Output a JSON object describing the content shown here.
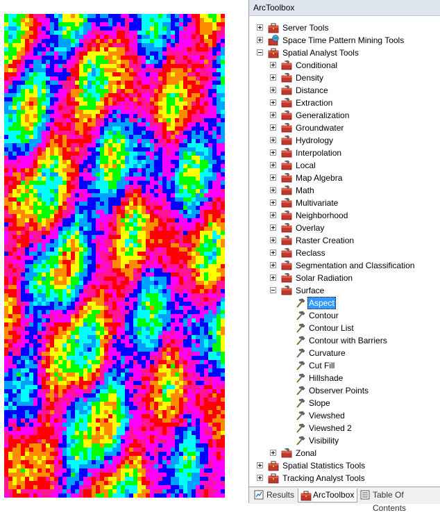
{
  "panel": {
    "title": "ArcToolbox"
  },
  "tree": [
    {
      "label": "Server Tools",
      "level": 0,
      "state": "collapsed",
      "icon": "toolbox-icon"
    },
    {
      "label": "Space Time Pattern Mining Tools",
      "level": 0,
      "state": "collapsed",
      "icon": "toolbox-globe-icon"
    },
    {
      "label": "Spatial Analyst Tools",
      "level": 0,
      "state": "expanded",
      "icon": "toolbox-icon"
    },
    {
      "label": "Conditional",
      "level": 1,
      "state": "collapsed",
      "icon": "toolset-icon"
    },
    {
      "label": "Density",
      "level": 1,
      "state": "collapsed",
      "icon": "toolset-icon"
    },
    {
      "label": "Distance",
      "level": 1,
      "state": "collapsed",
      "icon": "toolset-icon"
    },
    {
      "label": "Extraction",
      "level": 1,
      "state": "collapsed",
      "icon": "toolset-icon"
    },
    {
      "label": "Generalization",
      "level": 1,
      "state": "collapsed",
      "icon": "toolset-icon"
    },
    {
      "label": "Groundwater",
      "level": 1,
      "state": "collapsed",
      "icon": "toolset-icon"
    },
    {
      "label": "Hydrology",
      "level": 1,
      "state": "collapsed",
      "icon": "toolset-icon"
    },
    {
      "label": "Interpolation",
      "level": 1,
      "state": "collapsed",
      "icon": "toolset-icon"
    },
    {
      "label": "Local",
      "level": 1,
      "state": "collapsed",
      "icon": "toolset-icon"
    },
    {
      "label": "Map Algebra",
      "level": 1,
      "state": "collapsed",
      "icon": "toolset-icon"
    },
    {
      "label": "Math",
      "level": 1,
      "state": "collapsed",
      "icon": "toolset-icon"
    },
    {
      "label": "Multivariate",
      "level": 1,
      "state": "collapsed",
      "icon": "toolset-icon"
    },
    {
      "label": "Neighborhood",
      "level": 1,
      "state": "collapsed",
      "icon": "toolset-icon"
    },
    {
      "label": "Overlay",
      "level": 1,
      "state": "collapsed",
      "icon": "toolset-icon"
    },
    {
      "label": "Raster Creation",
      "level": 1,
      "state": "collapsed",
      "icon": "toolset-icon"
    },
    {
      "label": "Reclass",
      "level": 1,
      "state": "collapsed",
      "icon": "toolset-icon"
    },
    {
      "label": "Segmentation and Classification",
      "level": 1,
      "state": "collapsed",
      "icon": "toolset-icon"
    },
    {
      "label": "Solar Radiation",
      "level": 1,
      "state": "collapsed",
      "icon": "toolset-icon"
    },
    {
      "label": "Surface",
      "level": 1,
      "state": "expanded",
      "icon": "toolset-icon"
    },
    {
      "label": "Aspect",
      "level": 2,
      "state": "leaf",
      "icon": "hammer-icon",
      "selected": true
    },
    {
      "label": "Contour",
      "level": 2,
      "state": "leaf",
      "icon": "hammer-icon"
    },
    {
      "label": "Contour List",
      "level": 2,
      "state": "leaf",
      "icon": "hammer-icon"
    },
    {
      "label": "Contour with Barriers",
      "level": 2,
      "state": "leaf",
      "icon": "hammer-icon"
    },
    {
      "label": "Curvature",
      "level": 2,
      "state": "leaf",
      "icon": "hammer-icon"
    },
    {
      "label": "Cut Fill",
      "level": 2,
      "state": "leaf",
      "icon": "hammer-icon"
    },
    {
      "label": "Hillshade",
      "level": 2,
      "state": "leaf",
      "icon": "hammer-icon"
    },
    {
      "label": "Observer Points",
      "level": 2,
      "state": "leaf",
      "icon": "hammer-icon"
    },
    {
      "label": "Slope",
      "level": 2,
      "state": "leaf",
      "icon": "hammer-icon"
    },
    {
      "label": "Viewshed",
      "level": 2,
      "state": "leaf",
      "icon": "hammer-icon"
    },
    {
      "label": "Viewshed 2",
      "level": 2,
      "state": "leaf",
      "icon": "hammer-icon"
    },
    {
      "label": "Visibility",
      "level": 2,
      "state": "leaf",
      "icon": "hammer-icon"
    },
    {
      "label": "Zonal",
      "level": 1,
      "state": "collapsed",
      "icon": "toolset-icon"
    },
    {
      "label": "Spatial Statistics Tools",
      "level": 0,
      "state": "collapsed",
      "icon": "toolbox-icon"
    },
    {
      "label": "Tracking Analyst Tools",
      "level": 0,
      "state": "collapsed",
      "icon": "toolbox-icon"
    }
  ],
  "tabs": [
    {
      "label": "Results",
      "icon": "results-icon",
      "active": false
    },
    {
      "label": "ArcToolbox",
      "icon": "toolbox-icon",
      "active": true
    },
    {
      "label": "Table Of Contents",
      "icon": "table-of-contents-icon",
      "active": false
    }
  ],
  "colors": {
    "selection": "#3399ff",
    "toolbox_red": "#c0392b",
    "aspect_palette": [
      "#ff0000",
      "#ff8c00",
      "#ffff00",
      "#00ff00",
      "#00ffff",
      "#00a0ff",
      "#0000ff",
      "#ff00ff",
      "#ff1493"
    ]
  }
}
